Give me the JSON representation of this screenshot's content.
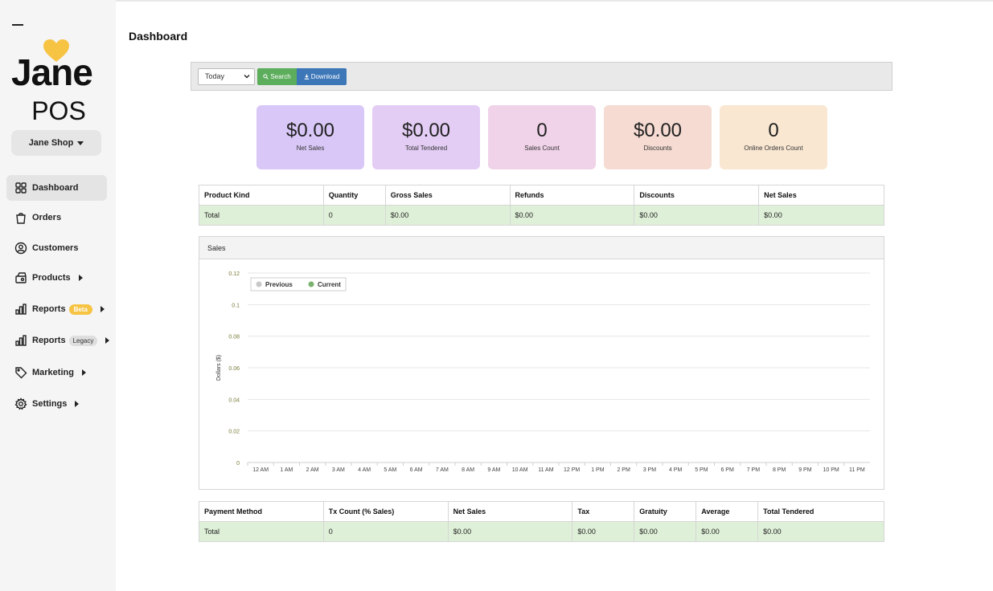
{
  "app": {
    "logo_word": "Jane",
    "logo_sub": "POS",
    "shop_label": "Jane Shop"
  },
  "sidebar": {
    "items": [
      {
        "label": "Dashboard",
        "icon": "grid-icon"
      },
      {
        "label": "Orders",
        "icon": "bag-icon"
      },
      {
        "label": "Customers",
        "icon": "user-circle-icon"
      },
      {
        "label": "Products",
        "icon": "products-icon"
      },
      {
        "label": "Reports",
        "icon": "bar-chart-icon",
        "badge": "Beta"
      },
      {
        "label": "Reports",
        "icon": "bar-chart-icon",
        "badge": "Legacy"
      },
      {
        "label": "Marketing",
        "icon": "tag-icon"
      },
      {
        "label": "Settings",
        "icon": "gear-icon"
      }
    ]
  },
  "page": {
    "title": "Dashboard"
  },
  "toolbar": {
    "range_value": "Today",
    "search_label": "Search",
    "download_label": "Download"
  },
  "cards": [
    {
      "value": "$0.00",
      "label": "Net Sales",
      "color": "#d9c8f7"
    },
    {
      "value": "$0.00",
      "label": "Total Tendered",
      "color": "#e3cdf5"
    },
    {
      "value": "0",
      "label": "Sales Count",
      "color": "#f0d3e8"
    },
    {
      "value": "$0.00",
      "label": "Discounts",
      "color": "#f5dbd2"
    },
    {
      "value": "0",
      "label": "Online Orders Count",
      "color": "#f9e7d2"
    }
  ],
  "product_table": {
    "headers": [
      "Product Kind",
      "Quantity",
      "Gross Sales",
      "Refunds",
      "Discounts",
      "Net Sales"
    ],
    "total_row": [
      "Total",
      "0",
      "$0.00",
      "$0.00",
      "$0.00",
      "$0.00"
    ]
  },
  "sales_panel": {
    "title": "Sales"
  },
  "chart_data": {
    "type": "line",
    "ylabel": "Dollars ($)",
    "xlabel": "",
    "ylim": [
      0,
      0.12
    ],
    "yticks": [
      "0.12",
      "0.1",
      "0.08",
      "0.06",
      "0.04",
      "0.02",
      "0"
    ],
    "categories": [
      "12 AM",
      "1 AM",
      "2 AM",
      "3 AM",
      "4 AM",
      "5 AM",
      "6 AM",
      "7 AM",
      "8 AM",
      "9 AM",
      "10 AM",
      "11 AM",
      "12 PM",
      "1 PM",
      "2 PM",
      "3 PM",
      "4 PM",
      "5 PM",
      "6 PM",
      "7 PM",
      "8 PM",
      "9 PM",
      "10 PM",
      "11 PM"
    ],
    "series": [
      {
        "name": "Previous",
        "color": "#c8c8c8",
        "values": []
      },
      {
        "name": "Current",
        "color": "#7ab26d",
        "values": []
      }
    ],
    "legend_position": "top-left",
    "grid": true
  },
  "payment_table": {
    "headers": [
      "Payment Method",
      "Tx Count (% Sales)",
      "Net Sales",
      "Tax",
      "Gratuity",
      "Average",
      "Total Tendered"
    ],
    "total_row": [
      "Total",
      "0",
      "$0.00",
      "$0.00",
      "$0.00",
      "$0.00",
      "$0.00"
    ]
  }
}
